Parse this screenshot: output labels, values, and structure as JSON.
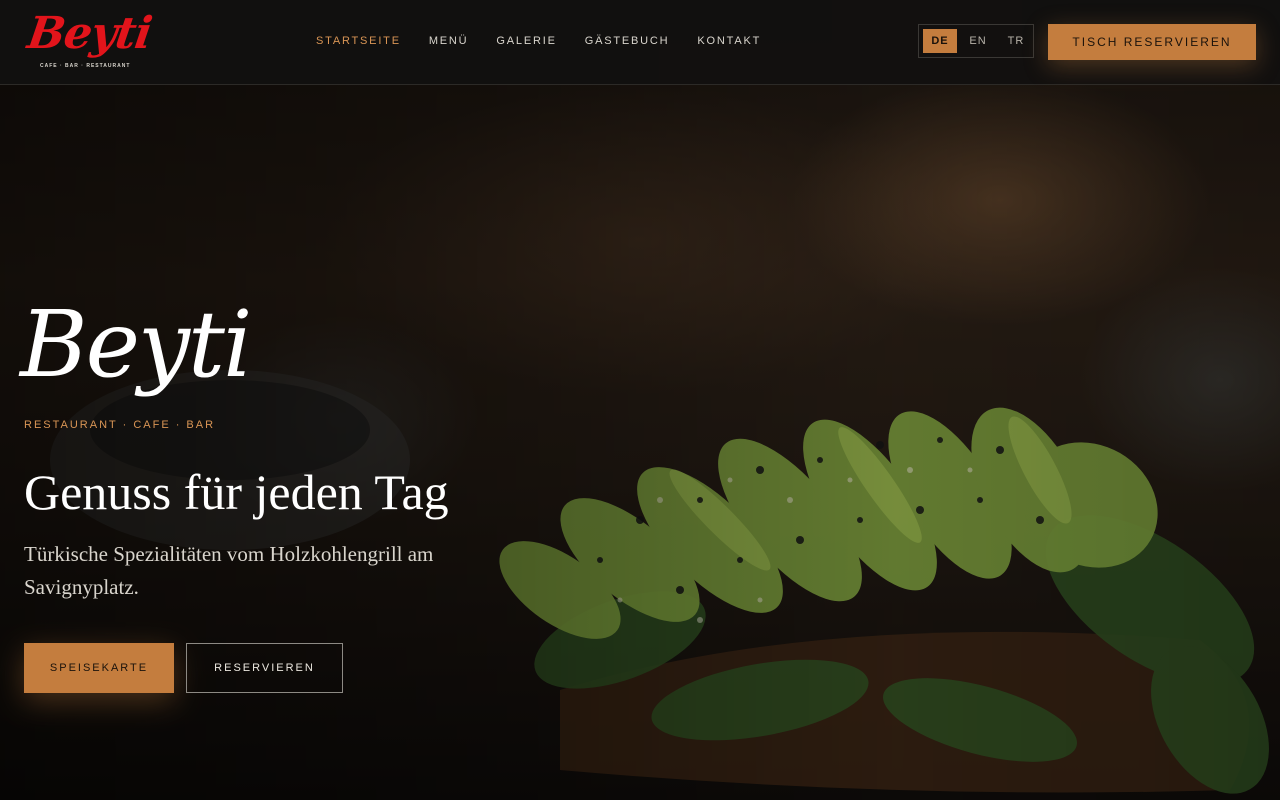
{
  "header": {
    "logo": {
      "text": "Beyti",
      "subtitle": "CAFE · BAR · RESTAURANT"
    },
    "nav": [
      {
        "label": "STARTSEITE",
        "active": true
      },
      {
        "label": "MENÜ",
        "active": false
      },
      {
        "label": "GALERIE",
        "active": false
      },
      {
        "label": "GÄSTEBUCH",
        "active": false
      },
      {
        "label": "KONTAKT",
        "active": false
      }
    ],
    "languages": [
      {
        "code": "DE",
        "active": true
      },
      {
        "code": "EN",
        "active": false
      },
      {
        "code": "TR",
        "active": false
      }
    ],
    "reserve_label": "TISCH RESERVIEREN"
  },
  "hero": {
    "title": "Beyti",
    "tagline": "RESTAURANT · CAFE · BAR",
    "heading": "Genuss für jeden Tag",
    "subtitle": "Türkische Spezialitäten vom Holzkohlengrill am Savignyplatz.",
    "primary_button": "SPEISEKARTE",
    "secondary_button": "RESERVIEREN"
  },
  "colors": {
    "accent": "#c47d3e",
    "accent_text": "#d99555",
    "logo_red": "#e2141b",
    "header_bg": "#121110"
  }
}
